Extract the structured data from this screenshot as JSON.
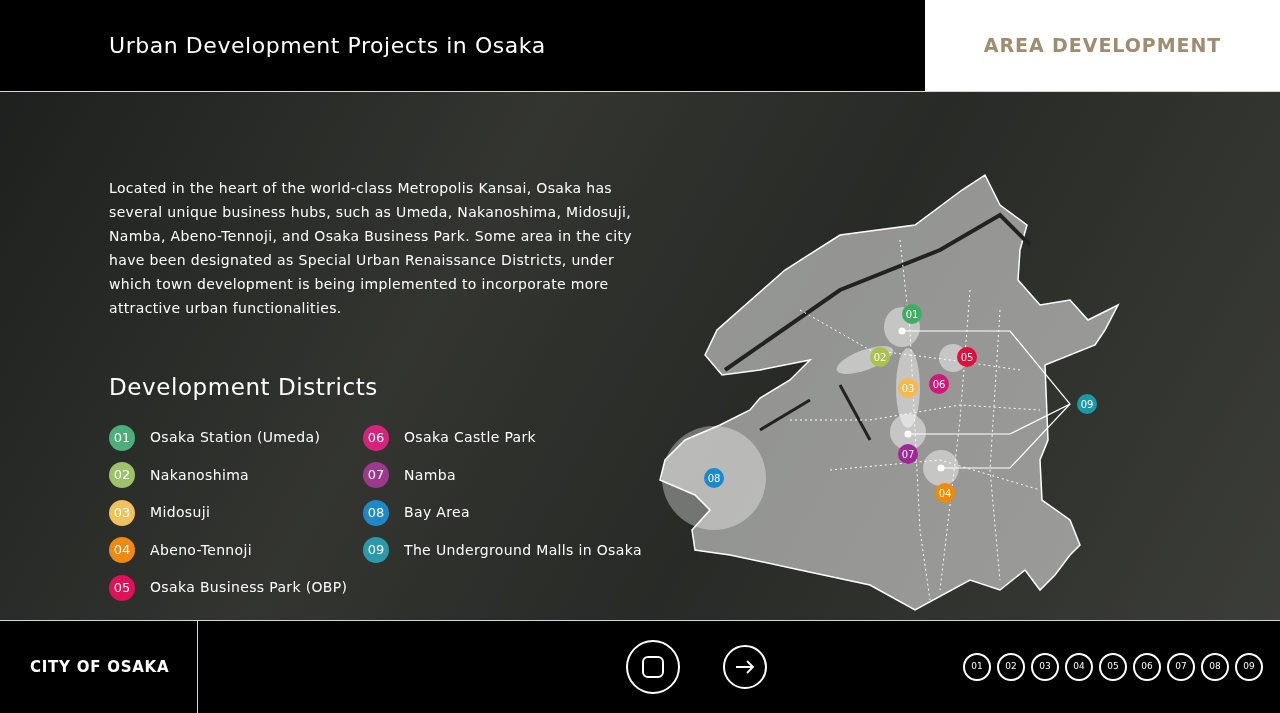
{
  "header": {
    "title": "Urban Development Projects in Osaka",
    "section": "AREA DEVELOPMENT"
  },
  "intro": "Located in the heart of the world-class Metropolis Kansai, Osaka has several unique business hubs, such as Umeda, Nakanoshima, Midosuji, Namba, Abeno-Tennoji, and Osaka Business Park. Some area in the city have been designated as Special Urban Renaissance Districts, under which town development is being implemented to incorporate more attractive urban functionalities.",
  "districts": {
    "title": "Development Districts",
    "items": [
      {
        "number": "01",
        "name": "Osaka Station (Umeda)",
        "color": "#4caf7a"
      },
      {
        "number": "02",
        "name": "Nakanoshima",
        "color": "#9cc26b"
      },
      {
        "number": "03",
        "name": "Midosuji",
        "color": "#f0c25e"
      },
      {
        "number": "04",
        "name": "Abeno-Tennoji",
        "color": "#ee8a12"
      },
      {
        "number": "05",
        "name": "Osaka Business Park (OBP)",
        "color": "#e0105a"
      },
      {
        "number": "06",
        "name": "Osaka Castle Park",
        "color": "#d6247c"
      },
      {
        "number": "07",
        "name": "Namba",
        "color": "#9b3a8c"
      },
      {
        "number": "08",
        "name": "Bay Area",
        "color": "#1e88c8"
      },
      {
        "number": "09",
        "name": "The Underground Malls in Osaka",
        "color": "#2a9aaa"
      }
    ]
  },
  "map": {
    "markers": [
      {
        "label": "01",
        "color": "#3fae62"
      },
      {
        "label": "02",
        "color": "#a8c24a"
      },
      {
        "label": "03",
        "color": "#f6b94a"
      },
      {
        "label": "04",
        "color": "#f08a00"
      },
      {
        "label": "05",
        "color": "#e0103c"
      },
      {
        "label": "06",
        "color": "#d0187a"
      },
      {
        "label": "07",
        "color": "#a0269a"
      },
      {
        "label": "08",
        "color": "#1a8ad0"
      },
      {
        "label": "09",
        "color": "#1a9aa8"
      }
    ]
  },
  "footer": {
    "brand": "CITY OF OSAKA",
    "pages": [
      "01",
      "02",
      "03",
      "04",
      "05",
      "06",
      "07",
      "08",
      "09"
    ]
  }
}
